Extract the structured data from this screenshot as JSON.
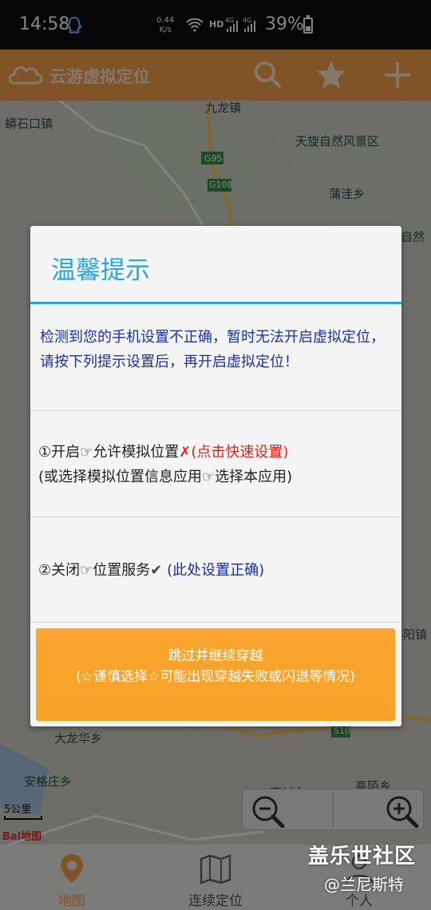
{
  "status_bar": {
    "time": "14:58",
    "speed_value": "0.44",
    "speed_unit": "K/s",
    "hd_label": "HD",
    "battery": "39%"
  },
  "app": {
    "title": "云游虚拟定位",
    "accent_color": "#f5a24c"
  },
  "header": {
    "icons": [
      "search-icon",
      "star-icon",
      "plus-icon"
    ]
  },
  "map": {
    "labels": [
      "蟒石口镇",
      "九龙镇",
      "天旋自然风景区",
      "G95",
      "G108",
      "蒲洼乡",
      "自然",
      "大龙华乡",
      "安格庄乡",
      "高陌乡",
      "亦阳镇",
      "S10",
      "高村乡"
    ],
    "scale_label": "5公里",
    "provider_label": "Bai地图"
  },
  "dialog": {
    "title": "温馨提示",
    "message": "检测到您的手机设置不正确，暂时无法开启虚拟定位，请按下列提示设置后，再开启虚拟定位！",
    "item1": {
      "text": "①开启☞允许模拟位置",
      "mark": "✗(点击快速设置)",
      "subtext": "(或选择模拟位置信息应用☞选择本应用)"
    },
    "item2": {
      "text": "②关闭☞位置服务",
      "check": "✔",
      "note": "(此处设置正确)"
    },
    "skip_button": {
      "line1": "跳过并继续穿越",
      "line2": "(☆谨慎选择☆可能出现穿越失败或闪退等情况)"
    }
  },
  "bottom_nav": {
    "items": [
      {
        "label": "地图",
        "icon": "map-pin-icon"
      },
      {
        "label": "连续定位",
        "icon": "folded-map-icon"
      },
      {
        "label": "个人",
        "icon": "person-icon"
      }
    ]
  },
  "watermark": {
    "line1": "盖乐世社区",
    "line2": "@兰尼斯特"
  }
}
